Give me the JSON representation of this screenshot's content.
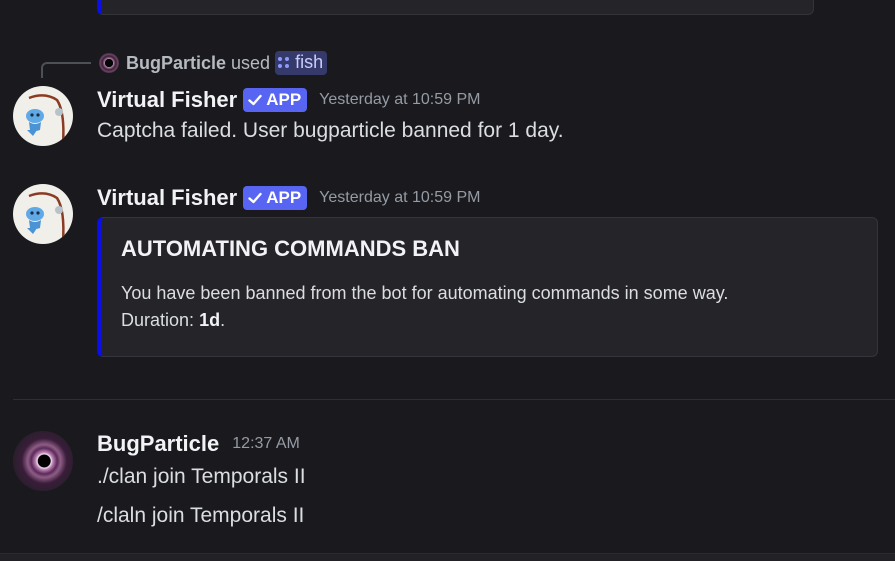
{
  "reply": {
    "user": "BugParticle",
    "action": "used",
    "command": "fish"
  },
  "messages": [
    {
      "author": "Virtual Fisher",
      "badge": "APP",
      "timestamp": "Yesterday at 10:59 PM",
      "text": "Captcha failed. User bugparticle banned for 1 day."
    },
    {
      "author": "Virtual Fisher",
      "badge": "APP",
      "timestamp": "Yesterday at 10:59 PM",
      "embed": {
        "title": "AUTOMATING COMMANDS BAN",
        "description": "You have been banned from the bot for automating commands in some way.",
        "duration_label": "Duration:",
        "duration_value": "1d",
        "duration_suffix": ".",
        "accent_color": "#0a0ee8"
      }
    },
    {
      "author": "BugParticle",
      "timestamp": "12:37 AM",
      "lines": [
        "./clan join Temporals II",
        "/claln join Temporals II"
      ]
    }
  ],
  "colors": {
    "background": "#1a1a1e",
    "app_badge": "#5865f2",
    "embed_bg": "#242429",
    "command_chip": "#353a6b"
  },
  "icons": {
    "badge_check": "checkmark-icon",
    "command": "slash-command-icon"
  }
}
